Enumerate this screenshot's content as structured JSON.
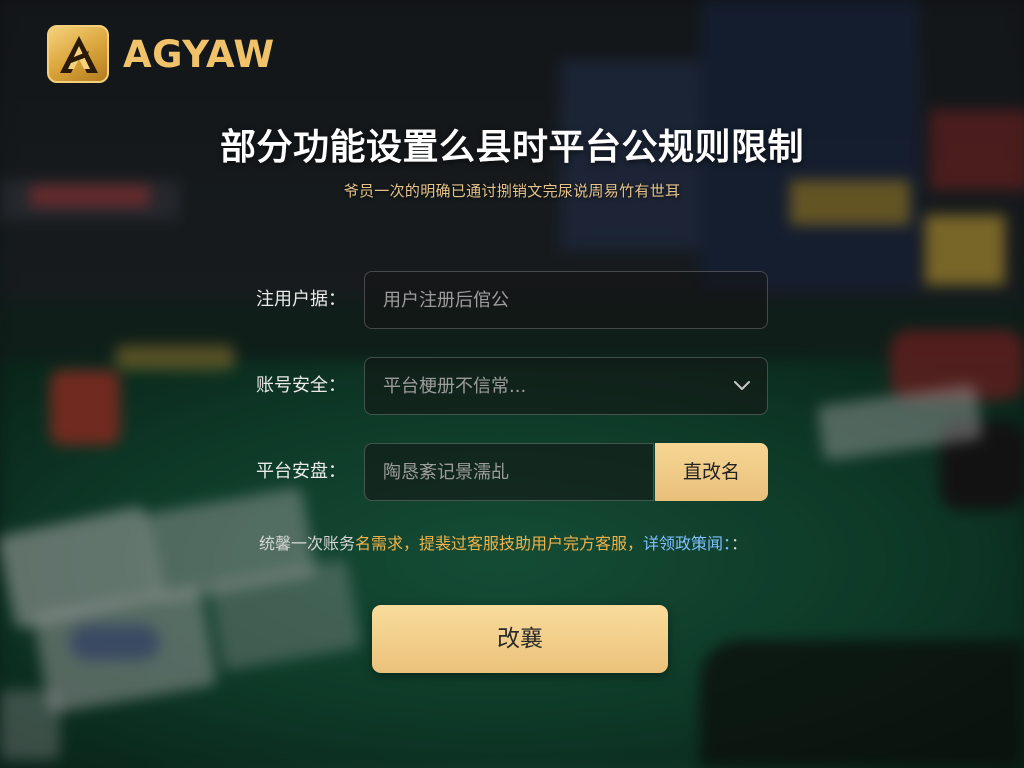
{
  "brand": {
    "name": "AGYAW",
    "accent": "#f0c36a"
  },
  "title": "部分功能设置么县时平台公规则限制",
  "subtitle": "爷员一次的明确已通讨捌销文完尿说周易竹有世耳",
  "form": {
    "username": {
      "label": "注用户据：",
      "placeholder": "用户注册后倌公"
    },
    "account_security": {
      "label": "账号安全：",
      "selected": "平台梗册不信常...",
      "icon": "chevron-down-icon"
    },
    "platform_security": {
      "label": "平台安盘：",
      "placeholder": "陶恳紊记景濡乩",
      "button_label": "直改名"
    }
  },
  "notice": {
    "part1": "统馨一次账务",
    "part2": "名需求，",
    "part3": "提裴过客服技助用户完方客服，",
    "part4": "详领政策闻：",
    "part5": "："
  },
  "submit_label": "改襄",
  "colors": {
    "button_gold": "#ebc27a",
    "notice_orange": "#f1b24a",
    "notice_blue": "#7fc1ff"
  }
}
